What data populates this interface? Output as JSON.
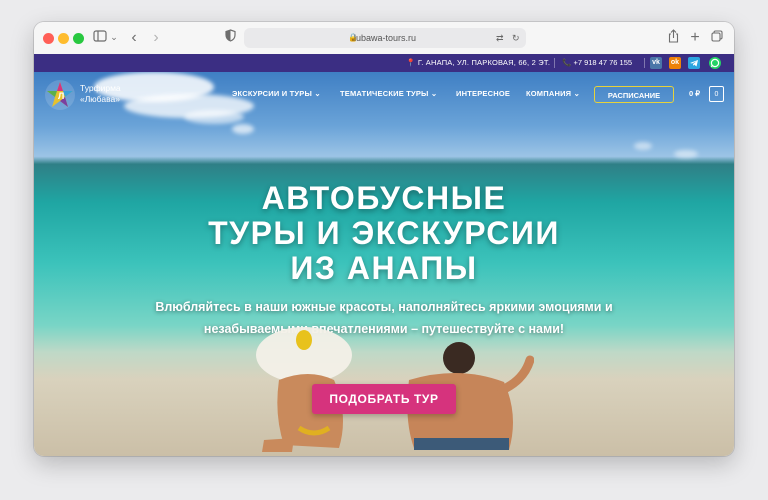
{
  "browser": {
    "url": "lubawa-tours.ru",
    "back_icon": "chevron-left-icon",
    "forward_icon": "chevron-right-icon"
  },
  "topbar": {
    "address": "Г. АНАПА, УЛ. ПАРКОВАЯ, 66, 2 ЭТ.",
    "phone": "+7 918 47 76 155",
    "social": [
      "VK",
      "OK",
      "Telegram",
      "WhatsApp"
    ]
  },
  "header": {
    "logo_line1": "Турфирма",
    "logo_line2": "«Любава»",
    "nav": [
      {
        "label": "ЭКСКУРСИИ И ТУРЫ"
      },
      {
        "label": "ТЕМАТИЧЕСКИЕ ТУРЫ"
      },
      {
        "label": "ИНТЕРЕСНОЕ"
      },
      {
        "label": "КОМПАНИЯ"
      }
    ],
    "schedule_label": "РАСПИСАНИЕ",
    "cart_total": "0 ₽",
    "cart_count": "0"
  },
  "hero": {
    "title_line1": "АВТОБУСНЫЕ",
    "title_line2": "ТУРЫ И ЭКСКУРСИИ",
    "title_line3": "ИЗ АНАПЫ",
    "subtitle_line1": "Влюбляйтесь в наши южные красоты, наполняйтесь яркими эмоциями и",
    "subtitle_line2": "незабываемыми впечатлениями – путешествуйте с нами!",
    "cta": "ПОДОБРАТЬ ТУР"
  },
  "colors": {
    "topbar_bg": "#3b2e83",
    "cta_bg": "#d6337d",
    "schedule_border": "#e6d23b"
  }
}
